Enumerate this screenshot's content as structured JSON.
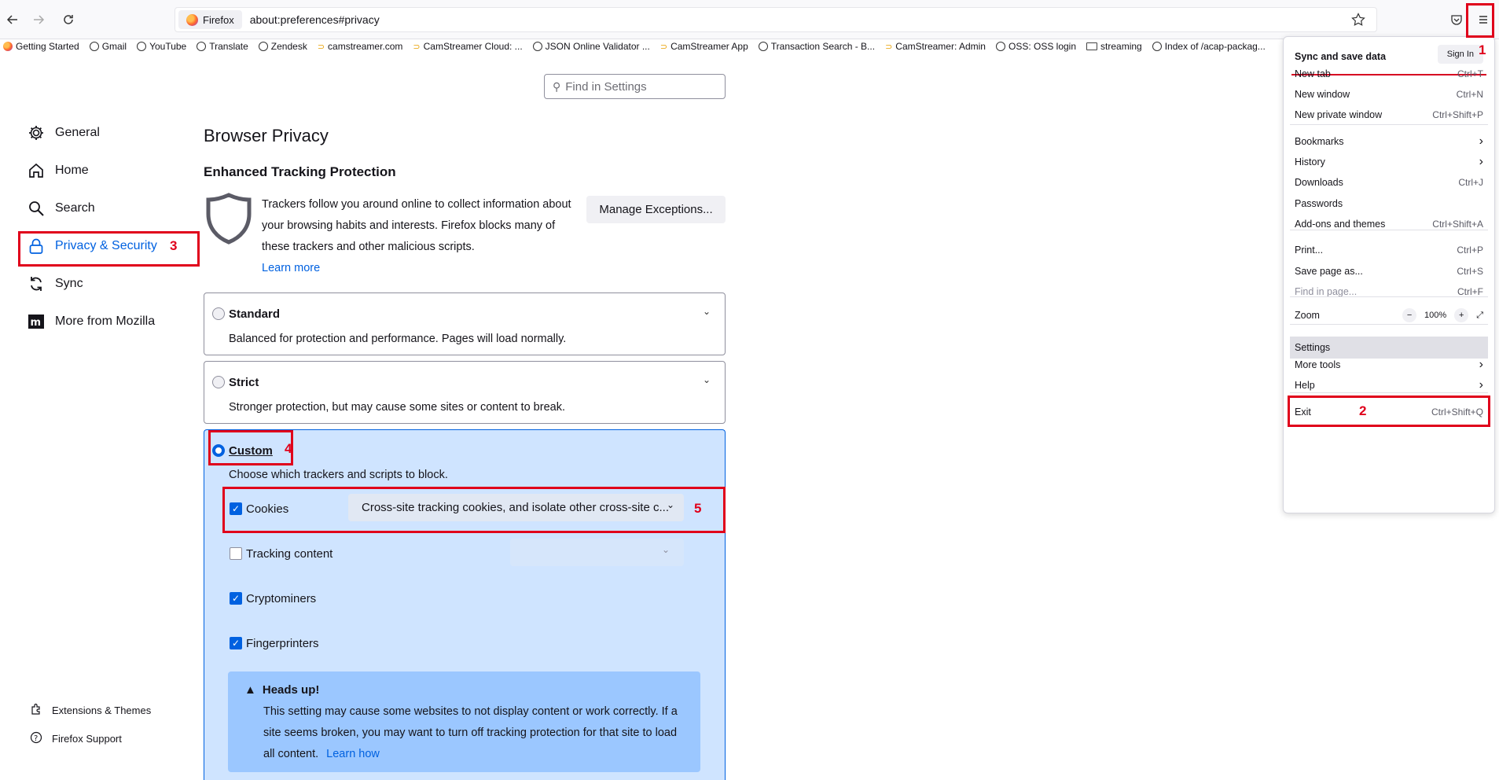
{
  "browser": {
    "identity": "Firefox",
    "url": "about:preferences#privacy"
  },
  "bookmarks": [
    {
      "label": "Getting Started",
      "icon": "firefox-icon"
    },
    {
      "label": "Gmail",
      "icon": "globe-icon"
    },
    {
      "label": "YouTube",
      "icon": "globe-icon"
    },
    {
      "label": "Translate",
      "icon": "globe-icon"
    },
    {
      "label": "Zendesk",
      "icon": "globe-icon"
    },
    {
      "label": "camstreamer.com",
      "icon": "camstreamer-icon"
    },
    {
      "label": "CamStreamer Cloud: ...",
      "icon": "camstreamer-icon"
    },
    {
      "label": "JSON Online Validator ...",
      "icon": "globe-icon"
    },
    {
      "label": "CamStreamer App",
      "icon": "camstreamer-icon"
    },
    {
      "label": "Transaction Search - B...",
      "icon": "globe-icon"
    },
    {
      "label": "CamStreamer: Admin",
      "icon": "camstreamer-icon"
    },
    {
      "label": "OSS: OSS login",
      "icon": "globe-icon"
    },
    {
      "label": "streaming",
      "icon": "folder-icon"
    },
    {
      "label": "Index of /acap-packag...",
      "icon": "globe-icon"
    }
  ],
  "search": {
    "placeholder": "Find in Settings"
  },
  "sidebar": {
    "items": [
      {
        "label": "General"
      },
      {
        "label": "Home"
      },
      {
        "label": "Search"
      },
      {
        "label": "Privacy & Security"
      },
      {
        "label": "Sync"
      },
      {
        "label": "More from Mozilla"
      }
    ],
    "footer": [
      {
        "label": "Extensions & Themes"
      },
      {
        "label": "Firefox Support"
      }
    ]
  },
  "main": {
    "title": "Browser Privacy",
    "etp_heading": "Enhanced Tracking Protection",
    "etp_description": "Trackers follow you around online to collect information about your browsing habits and interests. Firefox blocks many of these trackers and other malicious scripts.",
    "learn_more": "Learn more",
    "manage_exceptions": "Manage Exceptions...",
    "standard": {
      "title": "Standard",
      "desc": "Balanced for protection and performance. Pages will load normally."
    },
    "strict": {
      "title": "Strict",
      "desc": "Stronger protection, but may cause some sites or content to break."
    },
    "custom": {
      "title": "Custom",
      "desc": "Choose which trackers and scripts to block.",
      "cookies_label": "Cookies",
      "cookies_value": "Cross-site tracking cookies, and isolate other cross-site c...",
      "tracking_label": "Tracking content",
      "crypto_label": "Cryptominers",
      "finger_label": "Fingerprinters"
    },
    "warning": {
      "title": "Heads up!",
      "text": "This setting may cause some websites to not display content or work correctly. If a site seems broken, you may want to turn off tracking protection for that site to load all content.",
      "link": "Learn how"
    }
  },
  "menu": {
    "sync": "Sync and save data",
    "sign_in": "Sign In",
    "items": [
      {
        "label": "New tab",
        "shortcut": "Ctrl+T"
      },
      {
        "label": "New window",
        "shortcut": "Ctrl+N"
      },
      {
        "label": "New private window",
        "shortcut": "Ctrl+Shift+P"
      },
      {
        "label": "Bookmarks",
        "shortcut": ""
      },
      {
        "label": "History",
        "shortcut": ""
      },
      {
        "label": "Downloads",
        "shortcut": "Ctrl+J"
      },
      {
        "label": "Passwords",
        "shortcut": ""
      },
      {
        "label": "Add-ons and themes",
        "shortcut": "Ctrl+Shift+A"
      },
      {
        "label": "Print...",
        "shortcut": "Ctrl+P"
      },
      {
        "label": "Save page as...",
        "shortcut": "Ctrl+S"
      },
      {
        "label": "Find in page...",
        "shortcut": "Ctrl+F"
      },
      {
        "label": "Zoom",
        "shortcut": ""
      },
      {
        "label": "Settings",
        "shortcut": ""
      },
      {
        "label": "More tools",
        "shortcut": ""
      },
      {
        "label": "Help",
        "shortcut": ""
      },
      {
        "label": "Exit",
        "shortcut": "Ctrl+Shift+Q"
      }
    ],
    "zoom_value": "100%",
    "zoom_minus": "−",
    "zoom_plus": "+"
  },
  "annotations": [
    "1",
    "2",
    "3",
    "4",
    "5"
  ],
  "colors": {
    "accent": "#0061e0",
    "annotation": "#e0001b",
    "custom_bg": "#cfe4ff"
  }
}
